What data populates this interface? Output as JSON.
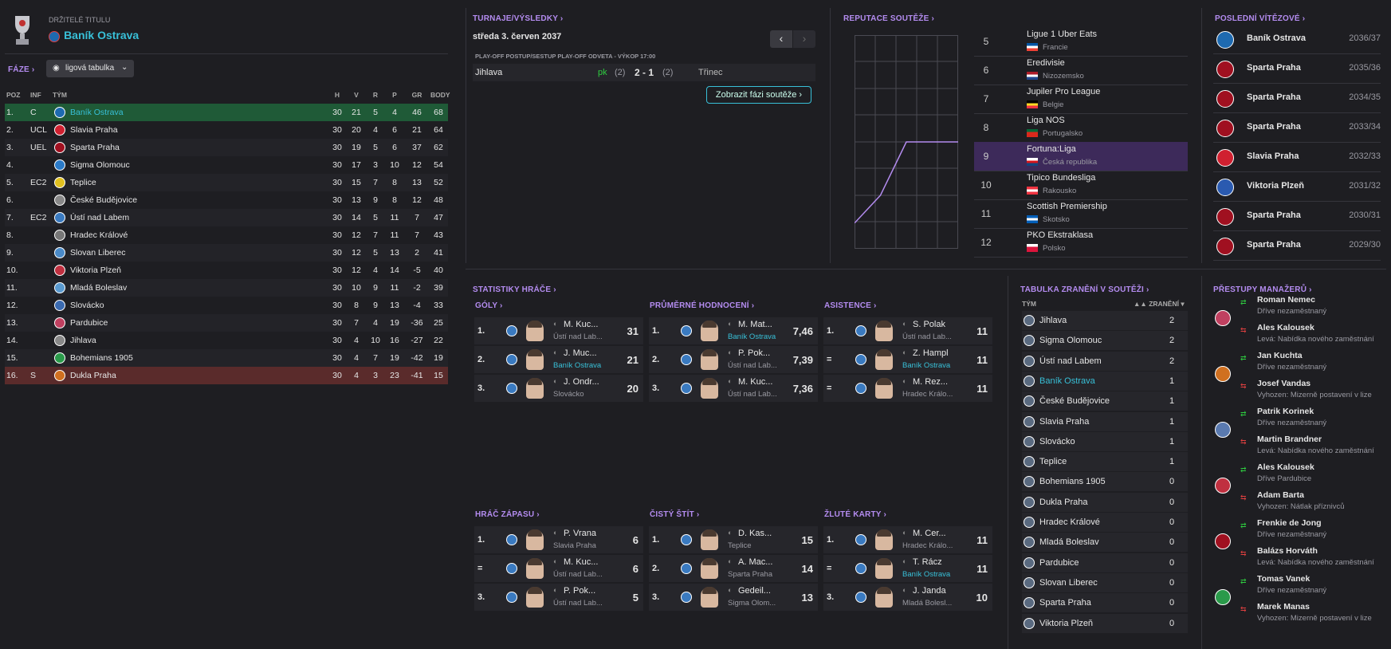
{
  "header": {
    "title_holders_label": "DRŽITELÉ TITULU",
    "holder_team": "Baník Ostrava"
  },
  "phase": {
    "label": "FÁZE",
    "dropdown": "ligová tabulka"
  },
  "league_table": {
    "columns": [
      "POZ",
      "INF",
      "TÝM",
      "H",
      "V",
      "R",
      "P",
      "GR",
      "BODY"
    ],
    "rows": [
      {
        "pos": "1.",
        "inf": "C",
        "team": "Baník Ostrava",
        "h": "30",
        "v": "21",
        "r": "5",
        "p": "4",
        "gr": "46",
        "body": "68",
        "color": "#1e6ab0"
      },
      {
        "pos": "2.",
        "inf": "UCL",
        "team": "Slavia Praha",
        "h": "30",
        "v": "20",
        "r": "4",
        "p": "6",
        "gr": "21",
        "body": "64",
        "color": "#d02030"
      },
      {
        "pos": "3.",
        "inf": "UEL",
        "team": "Sparta Praha",
        "h": "30",
        "v": "19",
        "r": "5",
        "p": "6",
        "gr": "37",
        "body": "62",
        "color": "#a01020"
      },
      {
        "pos": "4.",
        "inf": "",
        "team": "Sigma Olomouc",
        "h": "30",
        "v": "17",
        "r": "3",
        "p": "10",
        "gr": "12",
        "body": "54",
        "color": "#2a7ac8"
      },
      {
        "pos": "5.",
        "inf": "EC2",
        "team": "Teplice",
        "h": "30",
        "v": "15",
        "r": "7",
        "p": "8",
        "gr": "13",
        "body": "52",
        "color": "#e0c020"
      },
      {
        "pos": "6.",
        "inf": "",
        "team": "České Budějovice",
        "h": "30",
        "v": "13",
        "r": "9",
        "p": "8",
        "gr": "12",
        "body": "48",
        "color": "#888888"
      },
      {
        "pos": "7.",
        "inf": "EC2",
        "team": "Ústí nad Labem",
        "h": "30",
        "v": "14",
        "r": "5",
        "p": "11",
        "gr": "7",
        "body": "47",
        "color": "#3a7ac0"
      },
      {
        "pos": "8.",
        "inf": "",
        "team": "Hradec Králové",
        "h": "30",
        "v": "12",
        "r": "7",
        "p": "11",
        "gr": "7",
        "body": "43",
        "color": "#777777"
      },
      {
        "pos": "9.",
        "inf": "",
        "team": "Slovan Liberec",
        "h": "30",
        "v": "12",
        "r": "5",
        "p": "13",
        "gr": "2",
        "body": "41",
        "color": "#4a8ac8"
      },
      {
        "pos": "10.",
        "inf": "",
        "team": "Viktoria Plzeň",
        "h": "30",
        "v": "12",
        "r": "4",
        "p": "14",
        "gr": "-5",
        "body": "40",
        "color": "#c03040"
      },
      {
        "pos": "11.",
        "inf": "",
        "team": "Mladá Boleslav",
        "h": "30",
        "v": "10",
        "r": "9",
        "p": "11",
        "gr": "-2",
        "body": "39",
        "color": "#5a9ad0"
      },
      {
        "pos": "12.",
        "inf": "",
        "team": "Slovácko",
        "h": "30",
        "v": "8",
        "r": "9",
        "p": "13",
        "gr": "-4",
        "body": "33",
        "color": "#3a6ab0"
      },
      {
        "pos": "13.",
        "inf": "",
        "team": "Pardubice",
        "h": "30",
        "v": "7",
        "r": "4",
        "p": "19",
        "gr": "-36",
        "body": "25",
        "color": "#c04060"
      },
      {
        "pos": "14.",
        "inf": "",
        "team": "Jihlava",
        "h": "30",
        "v": "4",
        "r": "10",
        "p": "16",
        "gr": "-27",
        "body": "22",
        "color": "#888888"
      },
      {
        "pos": "15.",
        "inf": "",
        "team": "Bohemians 1905",
        "h": "30",
        "v": "4",
        "r": "7",
        "p": "19",
        "gr": "-42",
        "body": "19",
        "color": "#2a9a4a"
      },
      {
        "pos": "16.",
        "inf": "S",
        "team": "Dukla Praha",
        "h": "30",
        "v": "4",
        "r": "3",
        "p": "23",
        "gr": "-41",
        "body": "15",
        "color": "#d07020"
      }
    ]
  },
  "tournaments": {
    "title": "TURNAJE/VÝSLEDKY",
    "date": "středa 3. červen 2037",
    "match_header": "PLAY-OFF POSTUP/SESTUP PLAY-OFF ODVETA - VÝKOP 17:00",
    "home": "Jihlava",
    "pk": "pk",
    "home_pens": "(2)",
    "score": "2 - 1",
    "away_pens": "(2)",
    "away": "Třinec",
    "phase_button": "Zobrazit fázi soutěže"
  },
  "reputation": {
    "title": "REPUTACE SOUTĚŽE",
    "rows": [
      {
        "rank": "5",
        "league": "Ligue 1 Uber Eats",
        "country": "Francie"
      },
      {
        "rank": "6",
        "league": "Eredivisie",
        "country": "Nizozemsko"
      },
      {
        "rank": "7",
        "league": "Jupiler Pro League",
        "country": "Belgie"
      },
      {
        "rank": "8",
        "league": "Liga NOS",
        "country": "Portugalsko"
      },
      {
        "rank": "9",
        "league": "Fortuna:Liga",
        "country": "Česká republika"
      },
      {
        "rank": "10",
        "league": "Tipico Bundesliga",
        "country": "Rakousko"
      },
      {
        "rank": "11",
        "league": "Scottish Premiership",
        "country": "Skotsko"
      },
      {
        "rank": "12",
        "league": "PKO Ekstraklasa",
        "country": "Polsko"
      }
    ],
    "chart_levels": [
      0.12,
      0.25,
      0.5,
      0.5,
      0.5
    ]
  },
  "winners": {
    "title": "POSLEDNÍ VÍTĚZOVÉ",
    "rows": [
      {
        "team": "Baník Ostrava",
        "season": "2036/37"
      },
      {
        "team": "Sparta Praha",
        "season": "2035/36"
      },
      {
        "team": "Sparta Praha",
        "season": "2034/35"
      },
      {
        "team": "Sparta Praha",
        "season": "2033/34"
      },
      {
        "team": "Slavia Praha",
        "season": "2032/33"
      },
      {
        "team": "Viktoria Plzeň",
        "season": "2031/32"
      },
      {
        "team": "Sparta Praha",
        "season": "2030/31"
      },
      {
        "team": "Sparta Praha",
        "season": "2029/30"
      }
    ]
  },
  "player_stats": {
    "title": "STATISTIKY HRÁČE",
    "goals": {
      "title": "GÓLY",
      "rows": [
        {
          "rank": "1.",
          "name": "M. Kuc...",
          "club": "Ústí nad Lab...",
          "value": "31",
          "teal": false
        },
        {
          "rank": "2.",
          "name": "J. Muc...",
          "club": "Baník Ostrava",
          "value": "21",
          "teal": true
        },
        {
          "rank": "3.",
          "name": "J. Ondr...",
          "club": "Slovácko",
          "value": "20",
          "teal": false
        }
      ]
    },
    "ratings": {
      "title": "PRŮMĚRNÉ HODNOCENÍ",
      "rows": [
        {
          "rank": "1.",
          "name": "M. Mat...",
          "club": "Baník Ostrava",
          "value": "7,46",
          "teal": true
        },
        {
          "rank": "2.",
          "name": "P. Pok...",
          "club": "Ústí nad Lab...",
          "value": "7,39",
          "teal": false
        },
        {
          "rank": "3.",
          "name": "M. Kuc...",
          "club": "Ústí nad Lab...",
          "value": "7,36",
          "teal": false
        }
      ]
    },
    "assists": {
      "title": "ASISTENCE",
      "rows": [
        {
          "rank": "1.",
          "name": "S. Polak",
          "club": "Ústí nad Lab...",
          "value": "11",
          "teal": false
        },
        {
          "rank": "=",
          "name": "Z. Hampl",
          "club": "Baník Ostrava",
          "value": "11",
          "teal": true
        },
        {
          "rank": "=",
          "name": "M. Rez...",
          "club": "Hradec Králo...",
          "value": "11",
          "teal": false
        }
      ]
    },
    "motm": {
      "title": "HRÁČ ZÁPASU",
      "rows": [
        {
          "rank": "1.",
          "name": "P. Vrana",
          "club": "Slavia Praha",
          "value": "6",
          "teal": false
        },
        {
          "rank": "=",
          "name": "M. Kuc...",
          "club": "Ústí nad Lab...",
          "value": "6",
          "teal": false
        },
        {
          "rank": "3.",
          "name": "P. Pok...",
          "club": "Ústí nad Lab...",
          "value": "5",
          "teal": false
        }
      ]
    },
    "clean_sheets": {
      "title": "ČISTÝ ŠTÍT",
      "rows": [
        {
          "rank": "1.",
          "name": "D. Kas...",
          "club": "Teplice",
          "value": "15",
          "teal": false
        },
        {
          "rank": "2.",
          "name": "A. Mac...",
          "club": "Sparta Praha",
          "value": "14",
          "teal": false
        },
        {
          "rank": "3.",
          "name": "Gedeil...",
          "club": "Sigma Olom...",
          "value": "13",
          "teal": false
        }
      ]
    },
    "yellow": {
      "title": "ŽLUTÉ KARTY",
      "rows": [
        {
          "rank": "1.",
          "name": "M. Cer...",
          "club": "Hradec Králo...",
          "value": "11",
          "teal": false
        },
        {
          "rank": "=",
          "name": "T. Rácz",
          "club": "Baník Ostrava",
          "value": "11",
          "teal": true
        },
        {
          "rank": "3.",
          "name": "J. Janda",
          "club": "Mladá Bolesl...",
          "value": "10",
          "teal": false
        }
      ]
    }
  },
  "injuries": {
    "title": "TABULKA ZRANĚNÍ V SOUTĚŽI",
    "col_team": "TÝM",
    "col_inj": "ZRANĚNÍ",
    "rows": [
      {
        "team": "Jihlava",
        "n": "2"
      },
      {
        "team": "Sigma Olomouc",
        "n": "2"
      },
      {
        "team": "Ústí nad Labem",
        "n": "2"
      },
      {
        "team": "Baník Ostrava",
        "n": "1"
      },
      {
        "team": "České Budějovice",
        "n": "1"
      },
      {
        "team": "Slavia Praha",
        "n": "1"
      },
      {
        "team": "Slovácko",
        "n": "1"
      },
      {
        "team": "Teplice",
        "n": "1"
      },
      {
        "team": "Bohemians 1905",
        "n": "0"
      },
      {
        "team": "Dukla Praha",
        "n": "0"
      },
      {
        "team": "Hradec Králové",
        "n": "0"
      },
      {
        "team": "Mladá Boleslav",
        "n": "0"
      },
      {
        "team": "Pardubice",
        "n": "0"
      },
      {
        "team": "Slovan Liberec",
        "n": "0"
      },
      {
        "team": "Sparta Praha",
        "n": "0"
      },
      {
        "team": "Viktoria Plzeň",
        "n": "0"
      }
    ]
  },
  "transfers": {
    "title": "PŘESTUPY MANAŽERŮ",
    "rows": [
      {
        "name": "Roman Nemec",
        "note": "Dříve nezaměstnaný"
      },
      {
        "name": "Ales Kalousek",
        "note": "Levá: Nabídka nového zaměstnání"
      },
      {
        "name": "Jan Kuchta",
        "note": "Dříve nezaměstnaný"
      },
      {
        "name": "Josef Vandas",
        "note": "Vyhozen: Mizerně postavení v lize"
      },
      {
        "name": "Patrik Korinek",
        "note": "Dříve nezaměstnaný"
      },
      {
        "name": "Martin Brandner",
        "note": "Levá: Nabídka nového zaměstnání"
      },
      {
        "name": "Ales Kalousek",
        "note": "Dříve Pardubice"
      },
      {
        "name": "Adam Barta",
        "note": "Vyhozen: Nátlak příznivců"
      },
      {
        "name": "Frenkie de Jong",
        "note": "Dříve nezaměstnaný"
      },
      {
        "name": "Balázs Horváth",
        "note": "Levá: Nabídka nového zaměstnání"
      },
      {
        "name": "Tomas Vanek",
        "note": "Dříve nezaměstnaný"
      },
      {
        "name": "Marek Manas",
        "note": "Vyhozen: Mizerně postavení v lize"
      }
    ]
  }
}
